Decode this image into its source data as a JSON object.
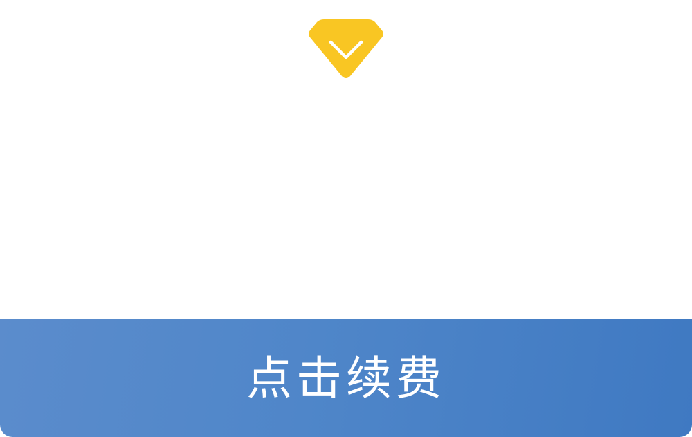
{
  "icon": {
    "name": "diamond-icon",
    "color": "#F9C623",
    "check_color": "#ffffff"
  },
  "button": {
    "label": "点击续费",
    "gradient_start": "#5b8ccc",
    "gradient_end": "#3f79c2",
    "text_color": "#ffffff"
  }
}
